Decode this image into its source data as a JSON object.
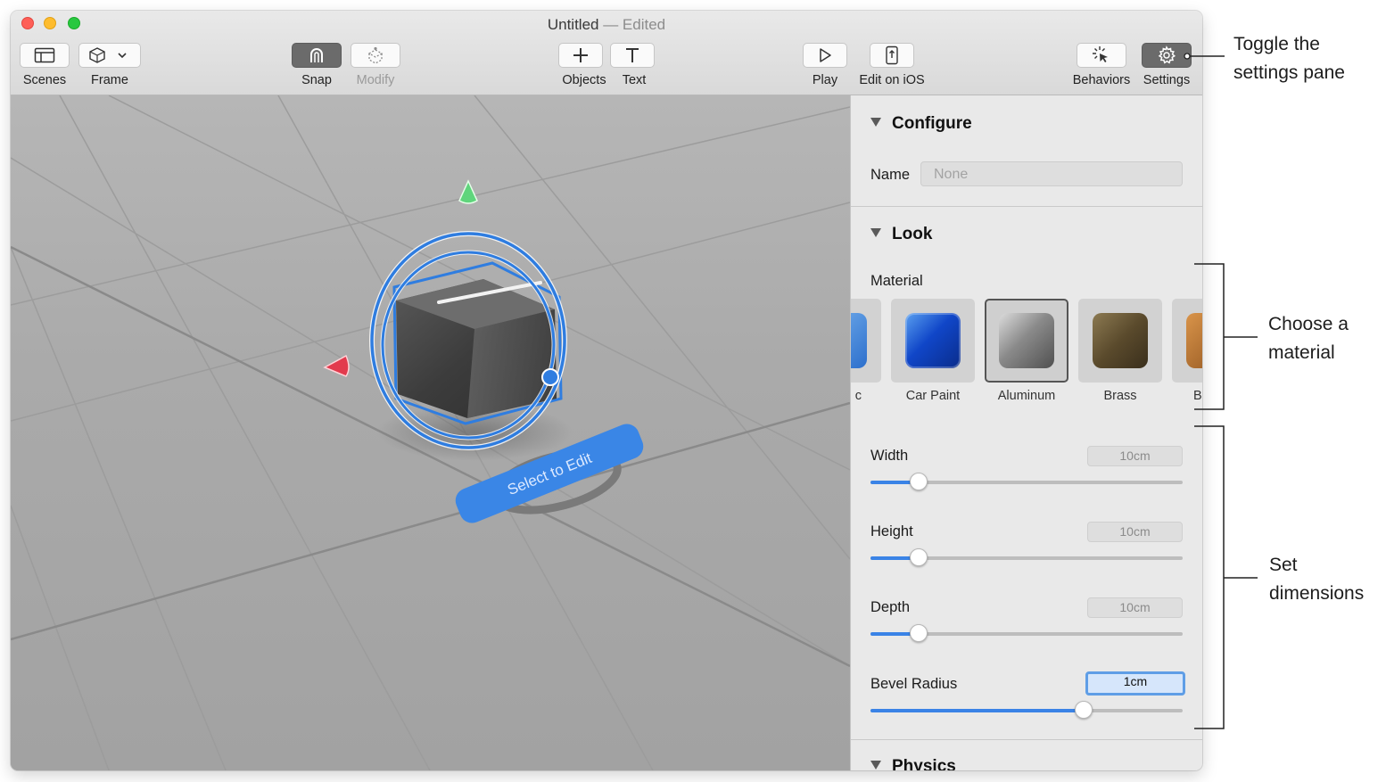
{
  "window": {
    "title": "Untitled",
    "title_suffix": " — Edited"
  },
  "toolbar": {
    "scenes": "Scenes",
    "frame": "Frame",
    "snap": "Snap",
    "modify": "Modify",
    "objects": "Objects",
    "text": "Text",
    "play": "Play",
    "edit_on_ios": "Edit on iOS",
    "behaviors": "Behaviors",
    "settings": "Settings"
  },
  "viewport": {
    "select_to_edit": "Select to Edit"
  },
  "panel": {
    "configure": {
      "title": "Configure",
      "name_label": "Name",
      "name_placeholder": "None"
    },
    "look": {
      "title": "Look",
      "material_label": "Material",
      "materials": [
        {
          "label": "c"
        },
        {
          "label": "Car Paint"
        },
        {
          "label": "Aluminum",
          "selected": true
        },
        {
          "label": "Brass"
        },
        {
          "label": "Br"
        }
      ],
      "width_label": "Width",
      "width_value": "10cm",
      "height_label": "Height",
      "height_value": "10cm",
      "depth_label": "Depth",
      "depth_value": "10cm",
      "bevel_label": "Bevel Radius",
      "bevel_value": "1cm"
    },
    "physics": {
      "title": "Physics"
    }
  },
  "callouts": {
    "settings_line1": "Toggle the",
    "settings_line2": "settings pane",
    "material_line1": "Choose a",
    "material_line2": "material",
    "dimensions_line1": "Set",
    "dimensions_line2": "dimensions"
  },
  "colors": {
    "accent": "#3a83e6",
    "close": "#fe5f57",
    "minimize": "#febc2e",
    "zoom": "#28c840"
  }
}
